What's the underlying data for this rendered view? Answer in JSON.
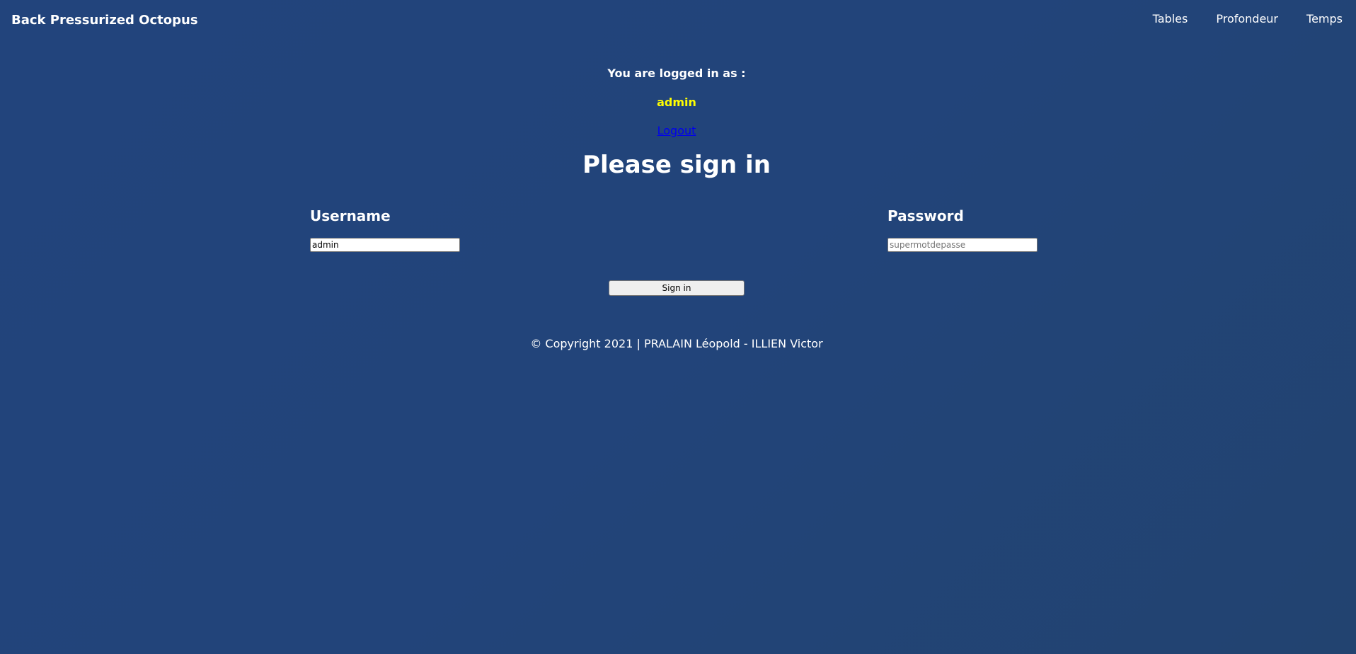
{
  "navbar": {
    "brand": "Back Pressurized Octopus",
    "links": [
      "Tables",
      "Profondeur",
      "Temps"
    ]
  },
  "session": {
    "logged_in_text": "You are logged in as :",
    "username": "admin",
    "logout_label": "Logout"
  },
  "form": {
    "title": "Please sign in",
    "username_label": "Username",
    "username_value": "admin",
    "password_label": "Password",
    "password_placeholder": "supermotdepasse",
    "submit_label": "Sign in"
  },
  "footer": {
    "text": "© Copyright 2021 | PRALAIN Léopold - ILLIEN Victor"
  },
  "colors": {
    "background": "#22447c",
    "username_highlight": "#ffff00",
    "link": "#0000ee"
  }
}
